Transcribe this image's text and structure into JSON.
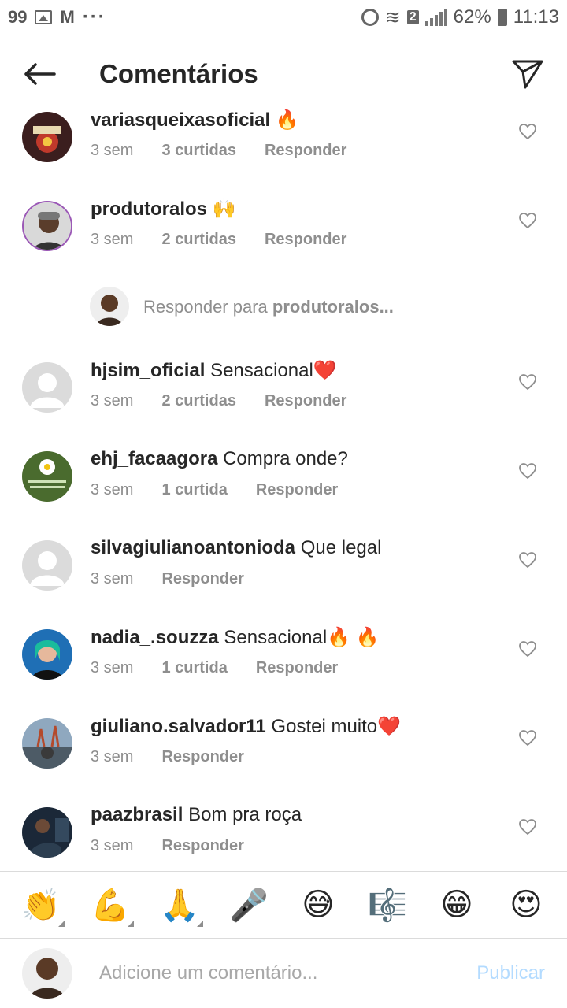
{
  "status_bar": {
    "notif_count": "99",
    "sim_badge": "2",
    "battery": "62%",
    "time": "11:13"
  },
  "header": {
    "title": "Comentários",
    "back_icon": "arrow-left-icon",
    "share_icon": "paper-plane-icon"
  },
  "comments": [
    {
      "username": "variasqueixasoficial",
      "text": "🔥",
      "age": "3 sem",
      "likes": "3 curtidas",
      "reply": "Responder"
    },
    {
      "username": "produtoralos",
      "text": "🙌",
      "age": "3 sem",
      "likes": "2 curtidas",
      "reply": "Responder"
    },
    {
      "username": "hjsim_oficial",
      "text": "Sensacional❤️",
      "age": "3 sem",
      "likes": "2 curtidas",
      "reply": "Responder"
    },
    {
      "username": "ehj_facaagora",
      "text": "Compra onde?",
      "age": "3 sem",
      "likes": "1 curtida",
      "reply": "Responder"
    },
    {
      "username": "silvagiulianoantonioda",
      "text": "Que legal",
      "age": "3 sem",
      "likes": "",
      "reply": "Responder"
    },
    {
      "username": "nadia_.souzza",
      "text": "Sensacional🔥 🔥",
      "age": "3 sem",
      "likes": "1 curtida",
      "reply": "Responder"
    },
    {
      "username": "giuliano.salvador11",
      "text": "Gostei muito❤️",
      "age": "3 sem",
      "likes": "",
      "reply": "Responder"
    },
    {
      "username": "paazbrasil",
      "text": "Bom pra roça",
      "age": "3 sem",
      "likes": "",
      "reply": "Responder"
    }
  ],
  "reply_prompt": {
    "prefix": "Responder para",
    "target": "produtoralos..."
  },
  "emoji_bar": [
    "👏",
    "💪",
    "🙏",
    "🎤",
    "😅",
    "🎼",
    "😁",
    "😍"
  ],
  "composer": {
    "placeholder": "Adicione um comentário...",
    "publish": "Publicar"
  },
  "colors": {
    "text": "#262626",
    "secondary": "#8e8e8e",
    "publish_disabled": "#b3dbff"
  }
}
